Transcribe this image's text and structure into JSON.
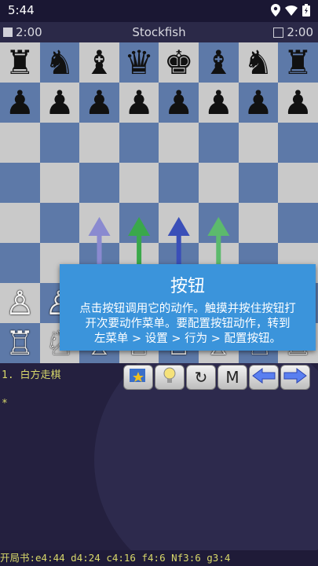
{
  "status_bar": {
    "time": "5:44",
    "icons": [
      "location-icon",
      "wifi-icon",
      "battery-icon"
    ]
  },
  "clock_bar": {
    "white_time": "2:00",
    "engine": "Stockfish",
    "black_time": "2:00"
  },
  "board": {
    "ranks": [
      [
        "♜",
        "♞",
        "♝",
        "♛",
        "♚",
        "♝",
        "♞",
        "♜"
      ],
      [
        "♟",
        "♟",
        "♟",
        "♟",
        "♟",
        "♟",
        "♟",
        "♟"
      ],
      [
        "",
        "",
        "",
        "",
        "",
        "",
        "",
        ""
      ],
      [
        "",
        "",
        "",
        "",
        "",
        "",
        "",
        ""
      ],
      [
        "",
        "",
        "",
        "",
        "",
        "",
        "",
        ""
      ],
      [
        "",
        "",
        "",
        "",
        "",
        "",
        "",
        ""
      ],
      [
        "♙",
        "♙",
        "♙",
        "♙",
        "♙",
        "♙",
        "♙",
        "♙"
      ],
      [
        "♖",
        "♘",
        "♗",
        "♕",
        "♔",
        "♗",
        "♘",
        "♖"
      ]
    ],
    "arrow_colors": [
      "#8a8ad0",
      "#3aa84a",
      "#3a4fb8",
      "#5cba6c"
    ]
  },
  "tooltip": {
    "title": "按钮",
    "body_lines": [
      "点击按钮调用它的动作。触摸并按住按钮打",
      "开次要动作菜单。要配置按钮动作，转到",
      "左菜单 > 设置 > 行为 > 配置按钮。"
    ]
  },
  "notation": {
    "move_line": "1. 白方走棋",
    "cursor": "*"
  },
  "buttons": [
    {
      "name": "mode-button",
      "icon": "flag-icon",
      "label": ""
    },
    {
      "name": "hint-button",
      "icon": "lightbulb-icon",
      "label": ""
    },
    {
      "name": "flip-board-button",
      "icon": "rotate-icon",
      "label": "↻"
    },
    {
      "name": "menu-button",
      "icon": "",
      "label": "M"
    },
    {
      "name": "undo-button",
      "icon": "arrow-left-icon",
      "label": ""
    },
    {
      "name": "redo-button",
      "icon": "arrow-right-icon",
      "label": ""
    }
  ],
  "book_line": "开局书:e4:44 d4:24 c4:16 f4:6 Nf3:6 g3:4"
}
